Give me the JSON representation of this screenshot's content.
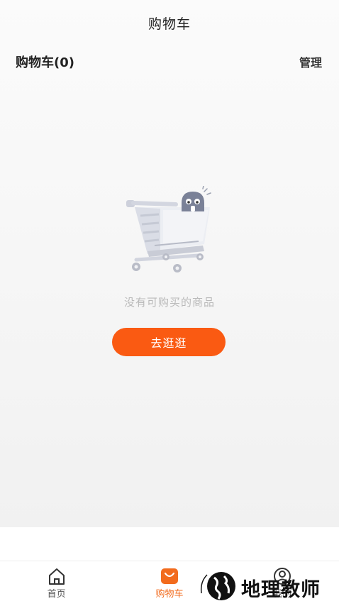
{
  "header": {
    "title": "购物车"
  },
  "cart": {
    "count_label": "购物车(0)",
    "manage_label": "管理"
  },
  "empty": {
    "message": "没有可购买的商品",
    "button_label": "去逛逛"
  },
  "tabbar": {
    "items": [
      {
        "label": "首页",
        "icon": "home-icon",
        "active": false
      },
      {
        "label": "购物车",
        "icon": "shopping-bag-icon",
        "active": true
      },
      {
        "label": "我的",
        "icon": "user-icon",
        "active": false
      }
    ]
  },
  "watermark": {
    "text": "地理教师"
  },
  "colors": {
    "accent": "#fa5a12",
    "active_tab": "#f26b1d",
    "background": "#f5f5f5"
  }
}
